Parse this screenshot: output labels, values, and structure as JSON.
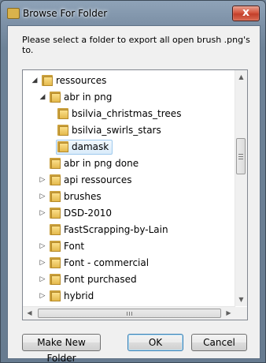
{
  "window": {
    "title": "Browse For Folder",
    "close_glyph": "x",
    "instruction": "Please select a folder to export all open brush .png's to."
  },
  "tree": {
    "items": [
      {
        "label": "ressources",
        "level": 1,
        "expander": "expanded"
      },
      {
        "label": "abr in png",
        "level": 2,
        "expander": "expanded"
      },
      {
        "label": "bsilvia_christmas_trees",
        "level": 3,
        "expander": "none"
      },
      {
        "label": "bsilvia_swirls_stars",
        "level": 3,
        "expander": "none"
      },
      {
        "label": "damask",
        "level": 3,
        "expander": "none",
        "selected": true
      },
      {
        "label": "abr in png done",
        "level": 2,
        "expander": "none"
      },
      {
        "label": "api ressources",
        "level": 2,
        "expander": "collapsed"
      },
      {
        "label": "brushes",
        "level": 2,
        "expander": "collapsed"
      },
      {
        "label": "DSD-2010",
        "level": 2,
        "expander": "collapsed"
      },
      {
        "label": "FastScrapping-by-Lain",
        "level": 2,
        "expander": "none"
      },
      {
        "label": "Font",
        "level": 2,
        "expander": "collapsed"
      },
      {
        "label": "Font - commercial",
        "level": 2,
        "expander": "collapsed"
      },
      {
        "label": "Font purchased",
        "level": 2,
        "expander": "collapsed"
      },
      {
        "label": "hybrid",
        "level": 2,
        "expander": "collapsed"
      }
    ]
  },
  "buttons": {
    "make_new_folder": "Make New Folder",
    "ok": "OK",
    "cancel": "Cancel"
  },
  "colors": {
    "selection": "#d9ebfa",
    "default_button_border": "#3c7fb1",
    "close_button": "#c33f2a"
  }
}
